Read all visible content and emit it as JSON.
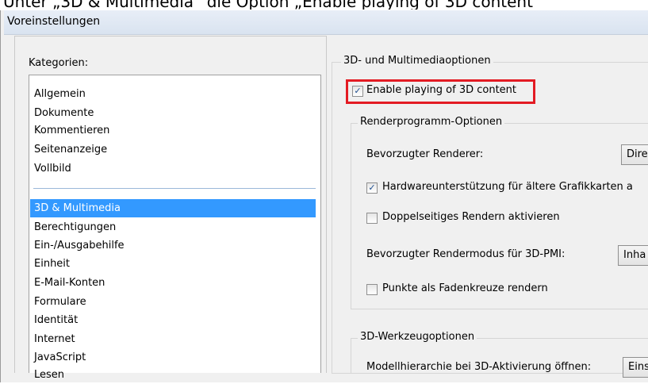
{
  "caption": "Unter „3D & Multimedia“ die Option „Enable playing of 3D content“",
  "window": {
    "title": "Voreinstellungen"
  },
  "categories": {
    "label": "Kategorien:",
    "top_items": [
      "Allgemein",
      "Dokumente",
      "Kommentieren",
      "Seitenanzeige",
      "Vollbild"
    ],
    "items": [
      "3D & Multimedia",
      "Berechtigungen",
      "Ein-/Ausgabehilfe",
      "Einheit",
      "E-Mail-Konten",
      "Formulare",
      "Identität",
      "Internet",
      "JavaScript",
      "Lesen"
    ],
    "selected": "3D & Multimedia"
  },
  "options": {
    "group_title": "3D- und Multimediaoptionen",
    "enable_3d": {
      "label": "Enable playing of 3D content",
      "checked": true
    },
    "render": {
      "group_title": "Renderprogramm-Optionen",
      "preferred_renderer": {
        "label": "Bevorzugter Renderer:",
        "value": "Dire"
      },
      "hw_support": {
        "label": "Hardwareunterstützung für ältere Grafikkarten a",
        "checked": true
      },
      "double_sided": {
        "label": "Doppelseitiges Rendern aktivieren",
        "checked": false
      },
      "pmi_mode": {
        "label": "Bevorzugter Rendermodus für 3D-PMI:",
        "value": "Inha"
      },
      "points_crosshair": {
        "label": "Punkte als Fadenkreuze rendern",
        "checked": false
      }
    },
    "tool": {
      "group_title": "3D-Werkzeugoptionen",
      "model_hierarchy": {
        "label": "Modellhierarchie bei 3D-Aktivierung öffnen:",
        "value": "Eins"
      }
    }
  },
  "colors": {
    "selection": "#3399ff",
    "highlight_border": "#e31b23",
    "checkmark": "#1f4f8f"
  }
}
